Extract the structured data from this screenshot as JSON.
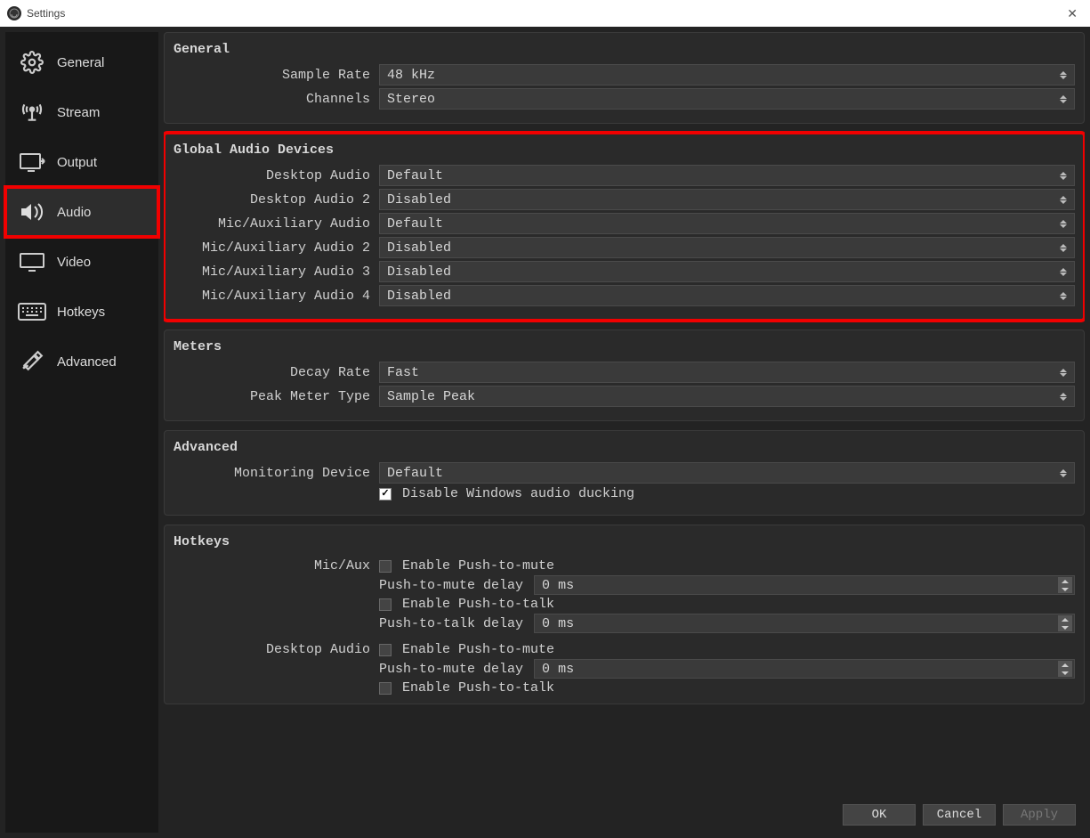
{
  "window": {
    "title": "Settings"
  },
  "sidebar": {
    "items": [
      {
        "label": "General"
      },
      {
        "label": "Stream"
      },
      {
        "label": "Output"
      },
      {
        "label": "Audio"
      },
      {
        "label": "Video"
      },
      {
        "label": "Hotkeys"
      },
      {
        "label": "Advanced"
      }
    ]
  },
  "groups": {
    "general": {
      "title": "General",
      "sample_rate": {
        "label": "Sample Rate",
        "value": "48 kHz"
      },
      "channels": {
        "label": "Channels",
        "value": "Stereo"
      }
    },
    "global_audio": {
      "title": "Global Audio Devices",
      "desktop_audio": {
        "label": "Desktop Audio",
        "value": "Default"
      },
      "desktop_audio_2": {
        "label": "Desktop Audio 2",
        "value": "Disabled"
      },
      "mic_aux": {
        "label": "Mic/Auxiliary Audio",
        "value": "Default"
      },
      "mic_aux_2": {
        "label": "Mic/Auxiliary Audio 2",
        "value": "Disabled"
      },
      "mic_aux_3": {
        "label": "Mic/Auxiliary Audio 3",
        "value": "Disabled"
      },
      "mic_aux_4": {
        "label": "Mic/Auxiliary Audio 4",
        "value": "Disabled"
      }
    },
    "meters": {
      "title": "Meters",
      "decay_rate": {
        "label": "Decay Rate",
        "value": "Fast"
      },
      "peak_type": {
        "label": "Peak Meter Type",
        "value": "Sample Peak"
      }
    },
    "advanced": {
      "title": "Advanced",
      "monitoring": {
        "label": "Monitoring Device",
        "value": "Default"
      },
      "ducking_label": "Disable Windows audio ducking"
    },
    "hotkeys": {
      "title": "Hotkeys",
      "mic": {
        "label": "Mic/Aux",
        "push_mute_enable": "Enable Push-to-mute",
        "push_mute_delay_label": "Push-to-mute delay",
        "push_mute_delay_value": "0",
        "push_mute_delay_unit": "ms",
        "push_talk_enable": "Enable Push-to-talk",
        "push_talk_delay_label": "Push-to-talk delay",
        "push_talk_delay_value": "0",
        "push_talk_delay_unit": "ms"
      },
      "desktop": {
        "label": "Desktop Audio",
        "push_mute_enable": "Enable Push-to-mute",
        "push_mute_delay_label": "Push-to-mute delay",
        "push_mute_delay_value": "0",
        "push_mute_delay_unit": "ms",
        "push_talk_enable": "Enable Push-to-talk"
      }
    }
  },
  "buttons": {
    "ok": "OK",
    "cancel": "Cancel",
    "apply": "Apply"
  }
}
